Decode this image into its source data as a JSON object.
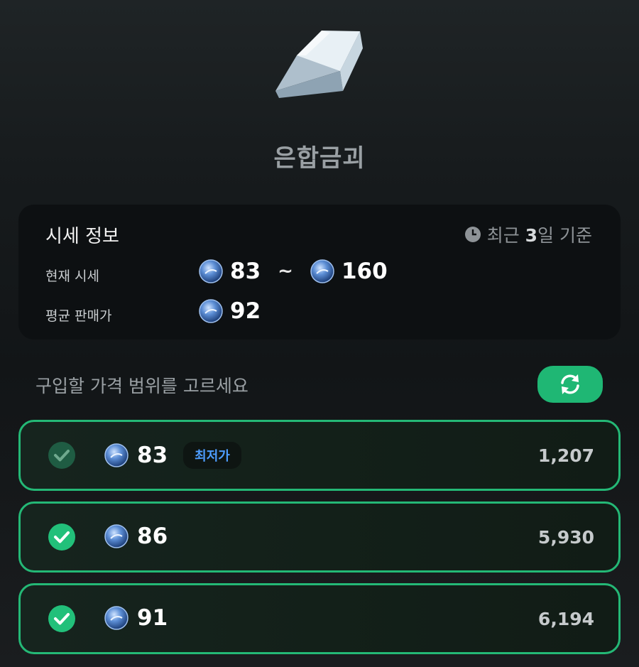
{
  "item": {
    "name": "은합금괴",
    "icon": "silver-ingot-icon"
  },
  "market_info": {
    "title": "시세 정보",
    "basis_prefix": "최근 ",
    "basis_days": "3",
    "basis_suffix": "일 기준",
    "current_label": "현재 시세",
    "current_min": "83",
    "current_separator": "~",
    "current_max": "160",
    "average_label": "평균 판매가",
    "average_value": "92"
  },
  "selection": {
    "prompt": "구입할 가격 범위를 고르세요",
    "refresh_icon": "refresh-icon"
  },
  "options": [
    {
      "price": "83",
      "badge": "최저가",
      "quantity": "1,207",
      "checked": true,
      "dimmed": true
    },
    {
      "price": "86",
      "badge": "",
      "quantity": "5,930",
      "checked": true,
      "dimmed": false
    },
    {
      "price": "91",
      "badge": "",
      "quantity": "6,194",
      "checked": true,
      "dimmed": false
    }
  ],
  "colors": {
    "accent": "#1fb774",
    "badge_text": "#4d9dff"
  }
}
